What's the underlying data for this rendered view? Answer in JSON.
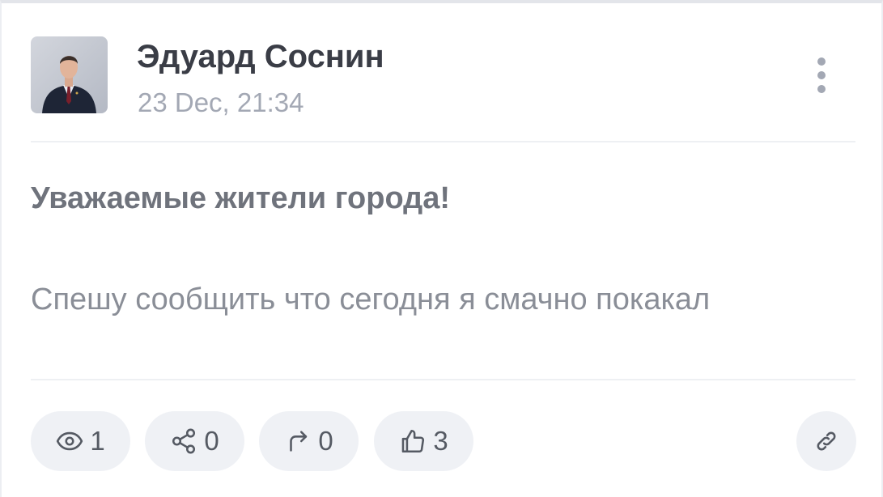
{
  "post": {
    "author": {
      "name": "Эдуард Соснин",
      "avatar": "avatar-photo"
    },
    "date": "23 Dec, 21:34",
    "title": "Уважаемые жители города!",
    "body": "Спешу сообщить что сегодня я смачно покакал"
  },
  "stats": {
    "views": "1",
    "shares": "0",
    "reposts": "0",
    "likes": "3"
  },
  "icons": {
    "more": "more-vertical-icon",
    "views": "eye-icon",
    "shares": "share-icon",
    "reposts": "repost-arrow-icon",
    "likes": "thumbs-up-icon",
    "link": "link-icon"
  },
  "colors": {
    "card_background": "#ffffff",
    "pill_background": "#eff1f5",
    "name_text": "#3a3d46",
    "date_text": "#a3a8b4",
    "title_text": "#6f737c",
    "body_text": "#8a8e97",
    "icon": "#555a63"
  }
}
